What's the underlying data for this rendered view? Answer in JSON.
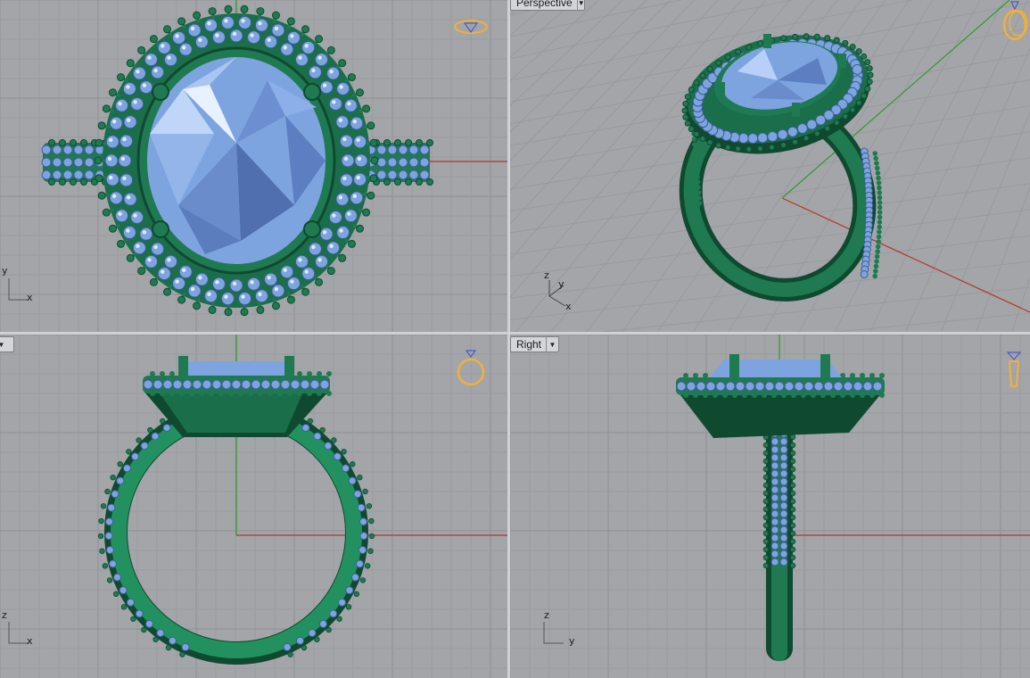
{
  "viewports": {
    "top": {
      "name": ""
    },
    "perspective": {
      "name": "Perspective"
    },
    "front": {
      "name": ""
    },
    "right": {
      "name": "Right"
    }
  },
  "axes": {
    "top": [
      "y",
      "x"
    ],
    "perspective": [
      "z",
      "y",
      "x"
    ],
    "front": [
      "z",
      "x"
    ],
    "right": [
      "z",
      "y"
    ]
  },
  "colors": {
    "viewport_bg": "#a3a5a8",
    "grid_minor": "#9a9c9f",
    "grid_major": "#8c8e92",
    "x_axis": "#b5352a",
    "y_axis": "#2e9a2e",
    "metal": "#1f7a52",
    "metal_dark": "#0f4a30",
    "metal_light": "#2fa56f",
    "gem": "#7ea4e0",
    "gem_dark": "#5b7fc0",
    "gem_light": "#cfe2ff",
    "nav_icon": "#f0b03a"
  },
  "icons": [
    "ring-top-icon",
    "ring-persp-icon",
    "ring-front-icon",
    "ring-right-icon"
  ]
}
